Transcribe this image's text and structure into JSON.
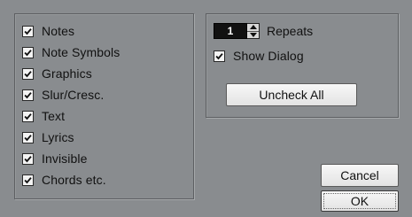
{
  "filter_options": {
    "items": [
      {
        "label": "Notes",
        "checked": true
      },
      {
        "label": "Note Symbols",
        "checked": true
      },
      {
        "label": "Graphics",
        "checked": true
      },
      {
        "label": "Slur/Cresc.",
        "checked": true
      },
      {
        "label": "Text",
        "checked": true
      },
      {
        "label": "Lyrics",
        "checked": true
      },
      {
        "label": "Invisible",
        "checked": true
      },
      {
        "label": "Chords etc.",
        "checked": true
      }
    ]
  },
  "repeats": {
    "value": "1",
    "label": "Repeats"
  },
  "show_dialog": {
    "label": "Show Dialog",
    "checked": true
  },
  "buttons": {
    "uncheck_all": "Uncheck All",
    "cancel": "Cancel",
    "ok": "OK"
  }
}
